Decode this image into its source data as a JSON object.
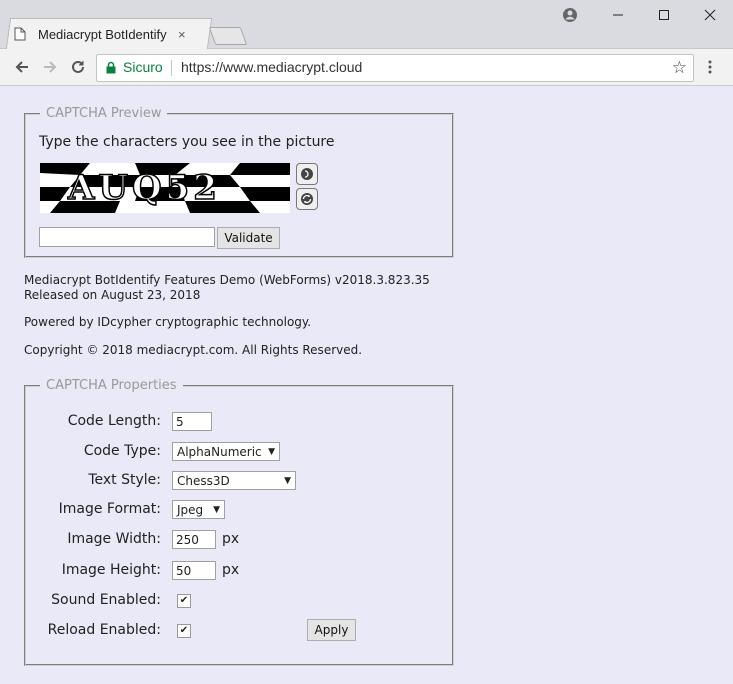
{
  "browser": {
    "tab_title": "Mediacrypt BotIdentify Fe",
    "tab_close": "×",
    "secure_label": "Sicuro",
    "url": "https://www.mediacrypt.cloud",
    "window_controls": [
      "–",
      "☐",
      "✕"
    ]
  },
  "preview": {
    "legend": "CAPTCHA Preview",
    "instruction": "Type the characters you see in the picture",
    "captcha_text": "AUQ52",
    "input_value": "",
    "validate_label": "Validate"
  },
  "info": {
    "line1": "Mediacrypt BotIdentify Features Demo (WebForms) v2018.3.823.35",
    "line2": "Released on August 23, 2018",
    "powered": "Powered by IDcypher cryptographic technology.",
    "copyright": "Copyright © 2018 mediacrypt.com. All Rights Reserved."
  },
  "props": {
    "legend": "CAPTCHA Properties",
    "code_length_label": "Code Length:",
    "code_length_value": "5",
    "code_type_label": "Code Type:",
    "code_type_value": "AlphaNumeric",
    "text_style_label": "Text Style:",
    "text_style_value": "Chess3D",
    "image_format_label": "Image Format:",
    "image_format_value": "Jpeg",
    "image_width_label": "Image Width:",
    "image_width_value": "250",
    "image_height_label": "Image Height:",
    "image_height_value": "50",
    "px": "px",
    "sound_label": "Sound Enabled:",
    "sound_checked": true,
    "reload_label": "Reload Enabled:",
    "reload_checked": true,
    "apply_label": "Apply"
  },
  "colors": {
    "page_bg": "#e9e9f7",
    "secure_green": "#0b8043"
  }
}
